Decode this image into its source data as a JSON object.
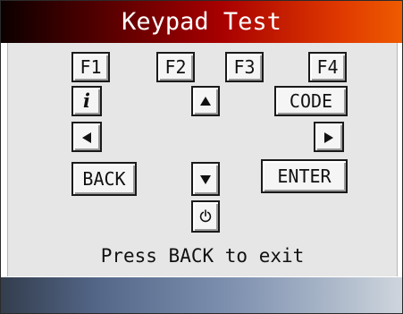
{
  "screen": {
    "title": "Keypad Test"
  },
  "keys": {
    "f1": "F1",
    "f2": "F2",
    "f3": "F3",
    "f4": "F4",
    "info": "i",
    "code": "CODE",
    "back": "BACK",
    "enter": "ENTER"
  },
  "icons": {
    "up": "up-arrow-icon",
    "down": "down-arrow-icon",
    "left": "left-arrow-icon",
    "right": "right-arrow-icon",
    "power": "power-icon",
    "info": "info-icon"
  },
  "footer": {
    "instruction": "Press BACK to exit"
  },
  "colors": {
    "title_gradient_start": "#0c0000",
    "title_gradient_end": "#ee5b00",
    "panel_bg": "#e6e6e6",
    "bottom_gradient_start": "#333d4d",
    "bottom_gradient_end": "#cfd5dd"
  }
}
